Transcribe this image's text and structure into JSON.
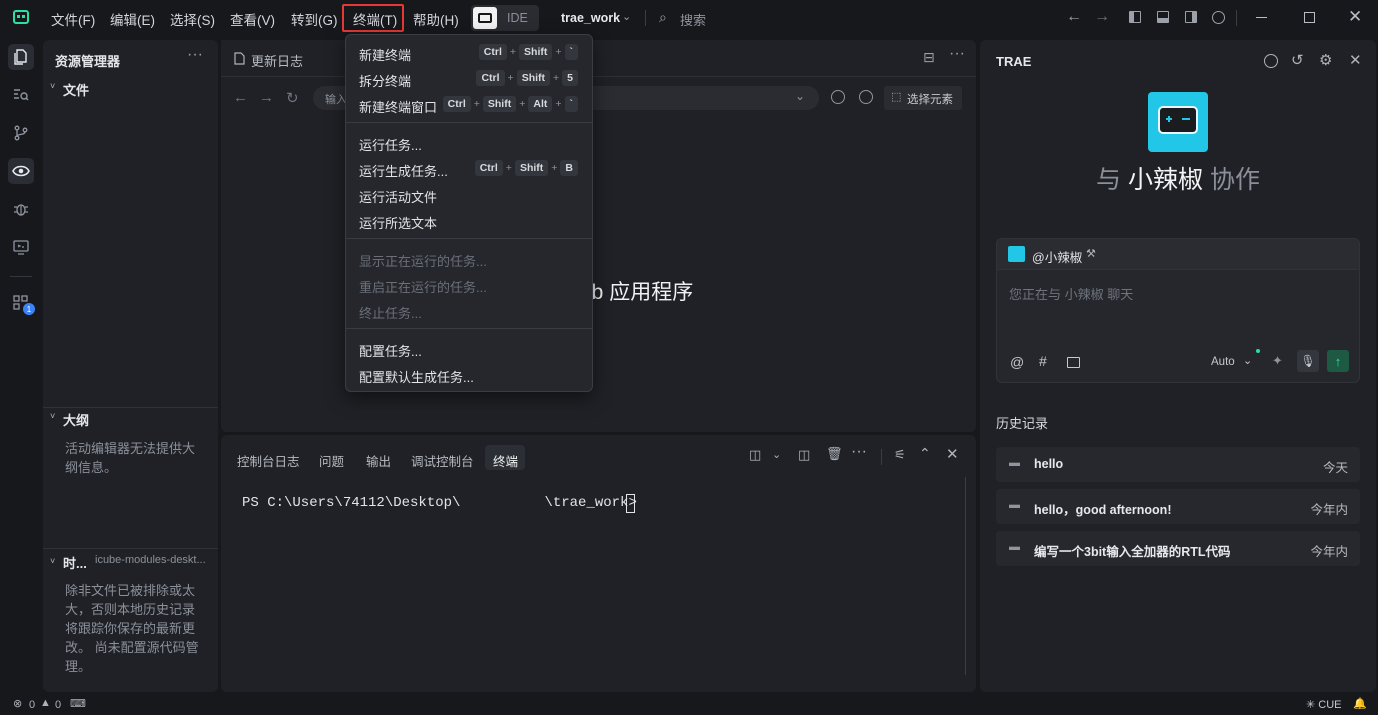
{
  "menubar": {
    "file": "文件(F)",
    "edit": "编辑(E)",
    "select": "选择(S)",
    "view": "查看(V)",
    "goto": "转到(G)",
    "terminal": "终端(T)",
    "help": "帮助(H)",
    "ide": "IDE",
    "project": "trae_work",
    "search": "搜索"
  },
  "explorer": {
    "title": "资源管理器",
    "files": "文件",
    "outline": "大纲",
    "outline_msg": "活动编辑器无法提供大纲信息。",
    "timeline": "时...",
    "timeline_file": "icube-modules-deskt...",
    "timeline_msg": "除非文件已被排除或太大，否则本地历史记录将跟踪你保存的最新更改。 尚未配置源代码管理。"
  },
  "editor": {
    "tab1": "更新日志",
    "url_placeholder": "输入",
    "select_element": "选择元素",
    "center_text": "eb 应用程序"
  },
  "terminal_menu": {
    "items": [
      {
        "label": "新建终端",
        "keys": [
          "Ctrl",
          "Shift",
          "`"
        ]
      },
      {
        "label": "拆分终端",
        "keys": [
          "Ctrl",
          "Shift",
          "5"
        ]
      },
      {
        "label": "新建终端窗口",
        "keys": [
          "Ctrl",
          "Shift",
          "Alt",
          "`"
        ]
      },
      {
        "label": "运行任务..."
      },
      {
        "label": "运行生成任务...",
        "keys": [
          "Ctrl",
          "Shift",
          "B"
        ]
      },
      {
        "label": "运行活动文件"
      },
      {
        "label": "运行所选文本"
      },
      {
        "label": "显示正在运行的任务...",
        "disabled": true
      },
      {
        "label": "重启正在运行的任务...",
        "disabled": true
      },
      {
        "label": "终止任务...",
        "disabled": true
      },
      {
        "label": "配置任务..."
      },
      {
        "label": "配置默认生成任务..."
      }
    ]
  },
  "bottom_panel": {
    "tabs": [
      "控制台日志",
      "问题",
      "输出",
      "调试控制台",
      "终端"
    ],
    "prompt_start": "PS C:\\Users\\74112\\Desktop\\",
    "prompt_end": "\\trae_work> "
  },
  "chat": {
    "title": "TRAE",
    "hero_prefix": "与 ",
    "hero_name": "小辣椒",
    "hero_suffix": " 协作",
    "agent_tag": "@小辣椒",
    "input_placeholder": "您正在与 小辣椒 聊天",
    "mode": "Auto",
    "history_title": "历史记录",
    "history": [
      {
        "title": "hello",
        "time": "今天"
      },
      {
        "title": "hello，good afternoon!",
        "time": "今年内"
      },
      {
        "title": "编写一个3bit输入全加器的RTL代码",
        "time": "今年内"
      }
    ]
  },
  "statusbar": {
    "errors": "0",
    "warnings": "0",
    "cue": "CUE",
    "badge": "1"
  },
  "colors": {
    "accent": "#2be0a1",
    "highlight": "#e53935",
    "avatar": "#22c6e6"
  }
}
